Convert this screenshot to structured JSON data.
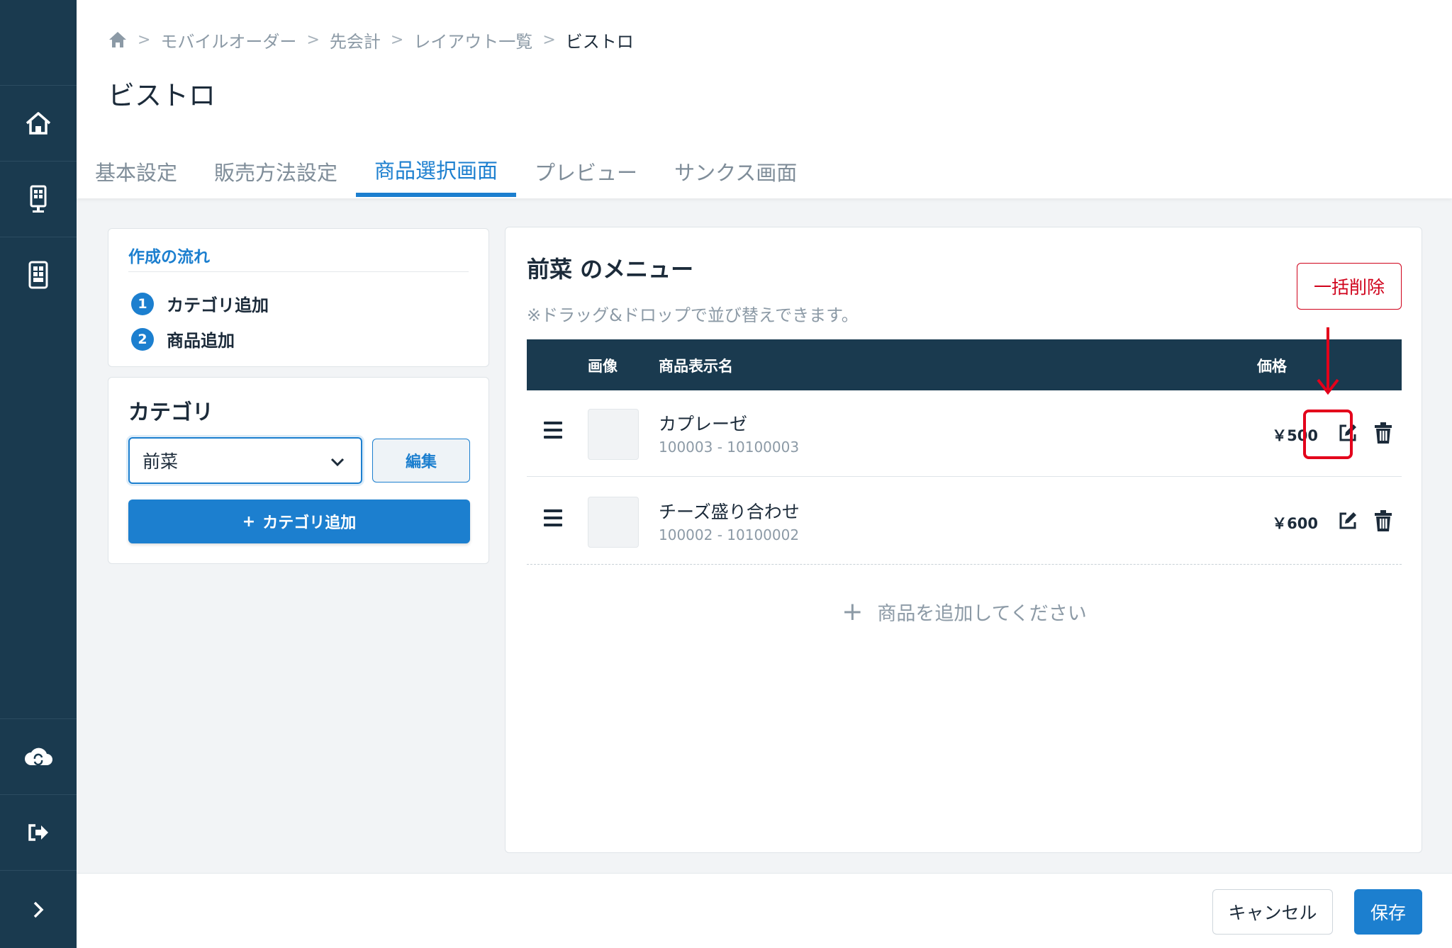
{
  "sidebar": {
    "items": [
      {
        "icon": "home-icon"
      },
      {
        "icon": "kiosk-icon"
      },
      {
        "icon": "tablet-icon"
      },
      {
        "icon": "cloud-sync-icon"
      },
      {
        "icon": "logout-icon"
      },
      {
        "icon": "chevron-right-icon"
      }
    ]
  },
  "breadcrumb": {
    "items": [
      "モバイルオーダー",
      "先会計",
      "レイアウト一覧"
    ],
    "current": "ビストロ",
    "separator": ">"
  },
  "page": {
    "title": "ビストロ"
  },
  "tabs": [
    {
      "label": "基本設定",
      "active": false
    },
    {
      "label": "販売方法設定",
      "active": false
    },
    {
      "label": "商品選択画面",
      "active": true
    },
    {
      "label": "プレビュー",
      "active": false
    },
    {
      "label": "サンクス画面",
      "active": false
    }
  ],
  "flow": {
    "title": "作成の流れ",
    "steps": [
      {
        "num": "1",
        "label": "カテゴリ追加"
      },
      {
        "num": "2",
        "label": "商品追加"
      }
    ]
  },
  "category": {
    "title": "カテゴリ",
    "selected": "前菜",
    "edit_label": "編集",
    "add_label": "カテゴリ追加",
    "add_prefix": "+"
  },
  "menu": {
    "title": "前菜 のメニュー",
    "hint": "※ドラッグ&ドロップで並び替えできます。",
    "bulk_delete_label": "一括削除",
    "columns": {
      "image": "画像",
      "name": "商品表示名",
      "price": "価格"
    },
    "rows": [
      {
        "name": "カプレーゼ",
        "code": "100003 - 10100003",
        "price": "￥500"
      },
      {
        "name": "チーズ盛り合わせ",
        "code": "100002 - 10100002",
        "price": "￥600"
      }
    ],
    "add_product_label": "商品を追加してください",
    "add_product_prefix": "+"
  },
  "footer": {
    "cancel_label": "キャンセル",
    "save_label": "保存"
  },
  "colors": {
    "sidebar": "#1a3a4f",
    "accent": "#1c7fcf",
    "danger": "#d0021b",
    "annotation": "#e3001b"
  }
}
